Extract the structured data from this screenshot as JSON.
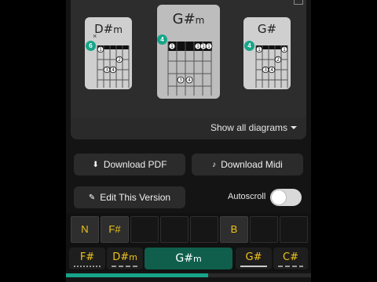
{
  "chords": [
    {
      "root": "D#",
      "suffix": "m",
      "badge": "6",
      "mute": "×",
      "fingers": [
        "1",
        "2",
        "3",
        "4"
      ]
    },
    {
      "root": "G#",
      "suffix": "m",
      "badge": "4",
      "fingers": [
        "1",
        "1",
        "1",
        "1",
        "3",
        "4"
      ]
    },
    {
      "root": "G#",
      "suffix": "",
      "badge": "4",
      "fingers": [
        "1",
        "1",
        "2",
        "3",
        "4"
      ]
    }
  ],
  "show_all_label": "Show all diagrams",
  "buttons": {
    "download_pdf": "Download PDF",
    "download_midi": "Download Midi",
    "edit_version": "Edit This Version"
  },
  "autoscroll": {
    "label": "Autoscroll",
    "on": false
  },
  "timeline": [
    "N",
    "F#",
    "",
    "",
    "",
    "B",
    "",
    ""
  ],
  "chord_bar": [
    {
      "root": "F#",
      "suffix": ""
    },
    {
      "root": "D#",
      "suffix": "m"
    },
    {
      "root": "G#",
      "suffix": "m",
      "active": true
    },
    {
      "root": "G#",
      "suffix": ""
    },
    {
      "root": "C#",
      "suffix": ""
    }
  ],
  "progress": 0.58,
  "colors": {
    "accent": "#17a589",
    "chord_text": "#f0c419",
    "background": "#141414"
  }
}
